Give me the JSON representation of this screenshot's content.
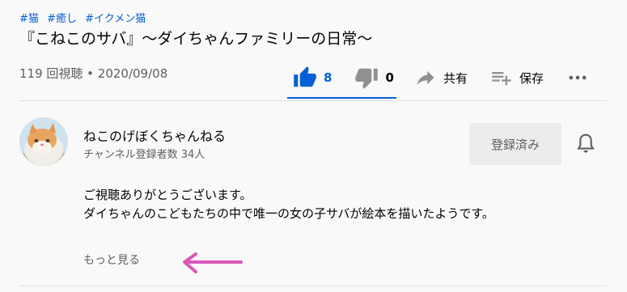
{
  "hashtags": [
    "#猫",
    "#癒し",
    "#イクメン猫"
  ],
  "video": {
    "title": "『こねこのサバ』〜ダイちゃんファミリーの日常〜",
    "meta": "119 回視聴 • 2020/09/08"
  },
  "actions": {
    "like_count": "8",
    "dislike_count": "0",
    "share_label": "共有",
    "save_label": "保存"
  },
  "channel": {
    "name": "ねこのげぼくちゃんねる",
    "subscribers": "チャンネル登録者数 34人",
    "subscribe_label": "登録済み"
  },
  "description": {
    "line1": "ご視聴ありがとうございます。",
    "line2": "ダイちゃんのこどもたちの中で唯一の女の子サバが絵本を描いたようです。"
  },
  "show_more_label": "もっと見る",
  "colors": {
    "accent": "#065fd4",
    "annotation_arrow": "#d957b8"
  }
}
